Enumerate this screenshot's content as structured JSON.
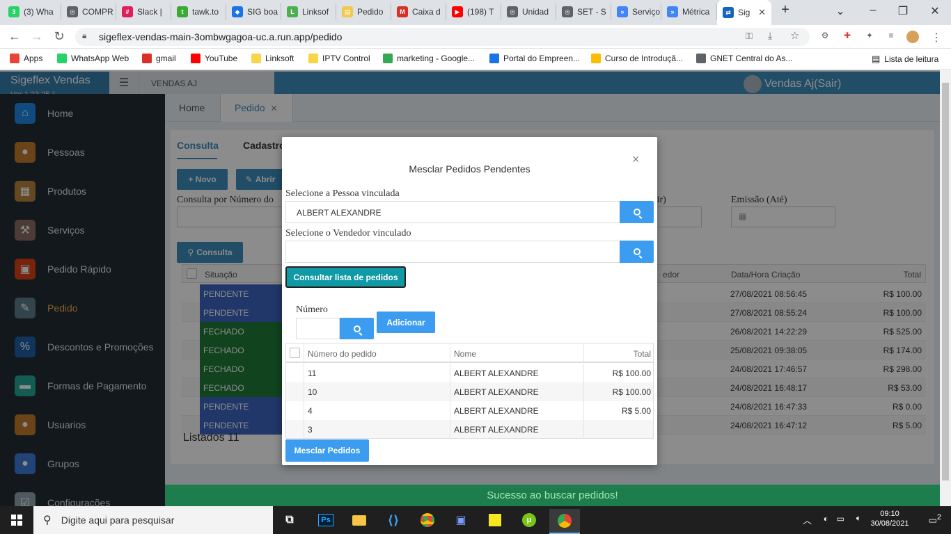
{
  "browser": {
    "tabs": [
      {
        "label": "(3) Wha",
        "color": "#25d366",
        "glyph": "3"
      },
      {
        "label": "COMPR",
        "color": "#5f6368",
        "glyph": "◎"
      },
      {
        "label": "Slack |",
        "color": "#e01e5a",
        "glyph": "#"
      },
      {
        "label": "tawk.to",
        "color": "#3aaa35",
        "glyph": "t"
      },
      {
        "label": "SIG boa",
        "color": "#1a73e8",
        "glyph": "◆"
      },
      {
        "label": "Linksof",
        "color": "#4caf50",
        "glyph": "L"
      },
      {
        "label": "Pedido",
        "color": "#f2c94c",
        "glyph": "▤"
      },
      {
        "label": "Caixa d",
        "color": "#d93025",
        "glyph": "M"
      },
      {
        "label": "(198) T",
        "color": "#ff0000",
        "glyph": "▶"
      },
      {
        "label": "Unidad",
        "color": "#5f6368",
        "glyph": "◎"
      },
      {
        "label": "SET - S",
        "color": "#5f6368",
        "glyph": "◎"
      },
      {
        "label": "Serviço",
        "color": "#4285f4",
        "glyph": "»"
      },
      {
        "label": "Métrica",
        "color": "#4285f4",
        "glyph": "»"
      },
      {
        "label": "Sig",
        "color": "#1565c0",
        "glyph": "⇄"
      }
    ],
    "url": "sigeflex-vendas-main-3ombwgagoa-uc.a.run.app/pedido",
    "bookmarks": [
      {
        "label": "Apps",
        "color": "#ea4335"
      },
      {
        "label": "WhatsApp Web",
        "color": "#25d366"
      },
      {
        "label": "gmail",
        "color": "#d93025"
      },
      {
        "label": "YouTube",
        "color": "#ff0000"
      },
      {
        "label": "Linksoft",
        "color": "#f9d547"
      },
      {
        "label": "IPTV Control",
        "color": "#f9d547"
      },
      {
        "label": "marketing - Google...",
        "color": "#34a853"
      },
      {
        "label": "Portal do Empreen...",
        "color": "#1a73e8"
      },
      {
        "label": "Curso de Introduçã...",
        "color": "#fbbc04"
      },
      {
        "label": "GNET Central do As...",
        "color": "#5f6368"
      }
    ],
    "reading_list": "Lista de leitura"
  },
  "app": {
    "brand": "Sigeflex Vendas",
    "version": "Ver 1.23.25.1",
    "company": "VENDAS AJ",
    "user": "Vendas Aj(Sair)",
    "sidebar": [
      {
        "label": "Home",
        "color": "#1e88e5",
        "glyph": "⌂"
      },
      {
        "label": "Pessoas",
        "color": "#c17c2c",
        "glyph": "●"
      },
      {
        "label": "Produtos",
        "color": "#b5833d",
        "glyph": "▦"
      },
      {
        "label": "Serviços",
        "color": "#8d6e63",
        "glyph": "⚒"
      },
      {
        "label": "Pedido Rápido",
        "color": "#d84315",
        "glyph": "▣"
      },
      {
        "label": "Pedido",
        "color": "#607d8b",
        "glyph": "✎"
      },
      {
        "label": "Descontos e Promoções",
        "color": "#1e5fa8",
        "glyph": "%"
      },
      {
        "label": "Formas de Pagamento",
        "color": "#26a69a",
        "glyph": "▬"
      },
      {
        "label": "Usuarios",
        "color": "#c17c2c",
        "glyph": "●"
      },
      {
        "label": "Grupos",
        "color": "#3d7bd8",
        "glyph": "●"
      },
      {
        "label": "Configurações",
        "color": "#90a4ae",
        "glyph": "☑"
      }
    ],
    "page_tabs": {
      "home": "Home",
      "pedido": "Pedido",
      "close": "✕"
    },
    "subtabs": {
      "consulta": "Consulta",
      "cadastro": "Cadastro"
    },
    "buttons": {
      "novo": "+ Novo",
      "abrir": "Abrir",
      "consulta": "Consulta"
    },
    "labels": {
      "consulta_numero": "Consulta por Número do",
      "emissao_partir": "rtir)",
      "emissao_ate": "Emissão (Até)"
    },
    "table": {
      "headers": {
        "situacao": "Situação",
        "vendedor": "edor",
        "data": "Data/Hora Criação",
        "total": "Total"
      },
      "rows": [
        {
          "situacao": "PENDENTE",
          "data": "27/08/2021 08:56:45",
          "total": "R$ 100.00"
        },
        {
          "situacao": "PENDENTE",
          "data": "27/08/2021 08:55:24",
          "total": "R$ 100.00"
        },
        {
          "situacao": "FECHADO",
          "data": "26/08/2021 14:22:29",
          "total": "R$ 525.00"
        },
        {
          "situacao": "FECHADO",
          "data": "25/08/2021 09:38:05",
          "total": "R$ 174.00"
        },
        {
          "situacao": "FECHADO",
          "data": "24/08/2021 17:46:57",
          "total": "R$ 298.00"
        },
        {
          "situacao": "FECHADO",
          "data": "24/08/2021 16:48:17",
          "total": "R$ 53.00"
        },
        {
          "situacao": "PENDENTE",
          "data": "24/08/2021 16:47:33",
          "total": "R$ 0.00"
        },
        {
          "situacao": "PENDENTE",
          "data": "24/08/2021 16:47:12",
          "total": "R$ 5.00"
        }
      ]
    },
    "listados": "Listados 11",
    "toast": "Sucesso ao buscar pedidos!"
  },
  "modal": {
    "title": "Mesclar Pedidos Pendentes",
    "close": "×",
    "pessoa_label": "Selecione a Pessoa vinculada",
    "pessoa_value": "ALBERT ALEXANDRE",
    "vendedor_label": "Selecione o Vendedor vinculado",
    "vendedor_value": "",
    "consultar_button": "Consultar lista de pedidos",
    "numero_label": "Número",
    "adicionar_button": "Adicionar",
    "table": {
      "headers": {
        "numero": "Número do pedido",
        "nome": "Nome",
        "total": "Total"
      },
      "rows": [
        {
          "numero": "11",
          "nome": "ALBERT ALEXANDRE",
          "total": "R$ 100.00"
        },
        {
          "numero": "10",
          "nome": "ALBERT ALEXANDRE",
          "total": "R$ 100.00"
        },
        {
          "numero": "4",
          "nome": "ALBERT ALEXANDRE",
          "total": "R$ 5.00"
        },
        {
          "numero": "3",
          "nome": "ALBERT ALEXANDRE",
          "total": ""
        }
      ]
    },
    "mesclar_button": "Mesclar Pedidos"
  },
  "taskbar": {
    "search_placeholder": "Digite aqui para pesquisar",
    "time": "09:10",
    "date": "30/08/2021",
    "notifications": "2"
  }
}
